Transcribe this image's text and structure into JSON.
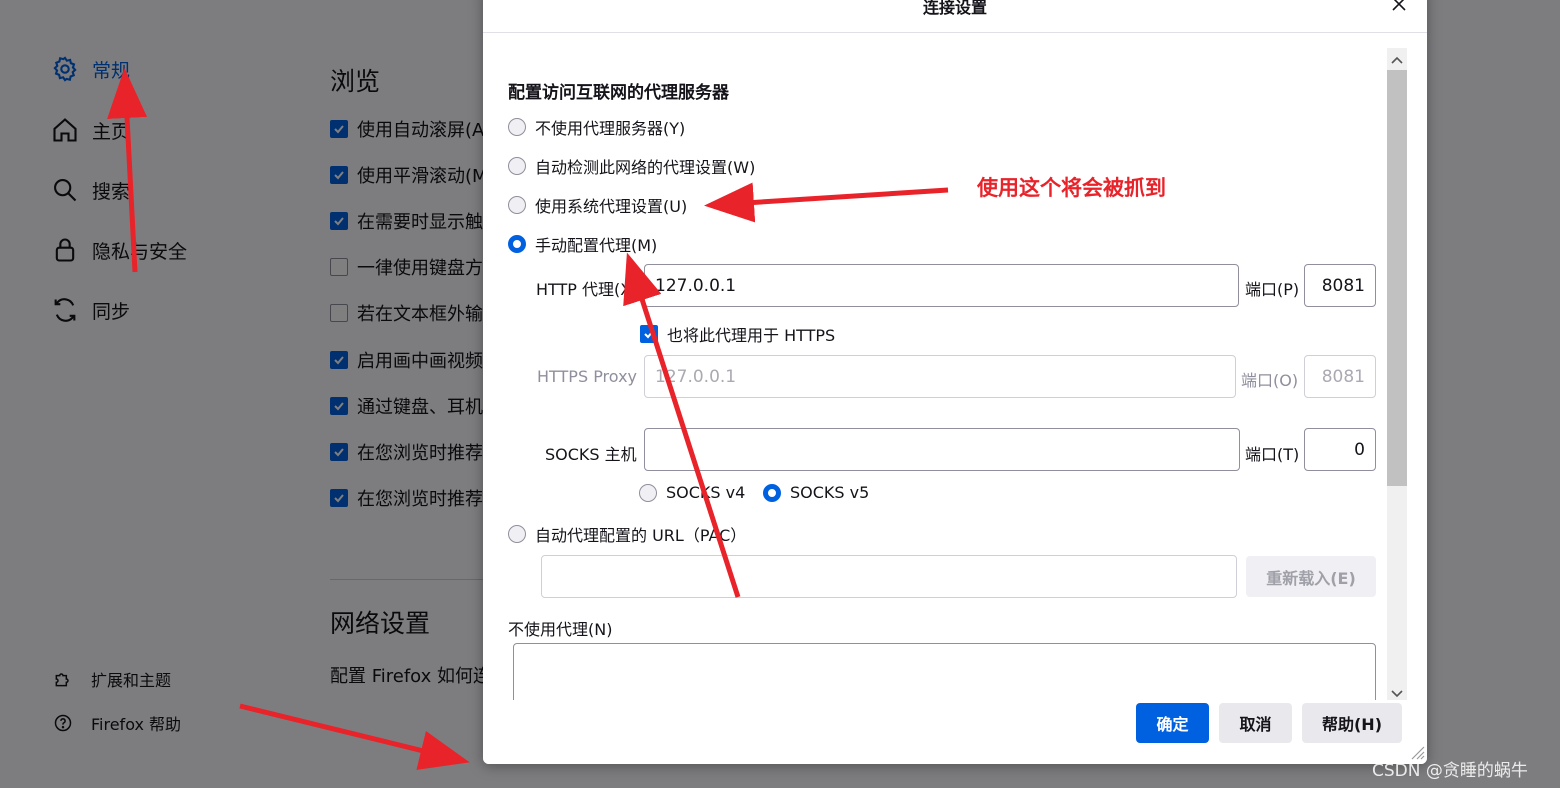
{
  "sidebar": {
    "items": [
      {
        "label": "常规",
        "icon": "gear-icon",
        "active": true
      },
      {
        "label": "主页",
        "icon": "home-icon"
      },
      {
        "label": "搜索",
        "icon": "search-icon"
      },
      {
        "label": "隐私与安全",
        "icon": "lock-icon"
      },
      {
        "label": "同步",
        "icon": "sync-icon"
      }
    ],
    "footer": [
      {
        "label": "扩展和主题",
        "icon": "puzzle-icon"
      },
      {
        "label": "Firefox 帮助",
        "icon": "help-icon"
      }
    ]
  },
  "browse": {
    "title": "浏览",
    "options": [
      {
        "label": "使用自动滚屏(A",
        "checked": true
      },
      {
        "label": "使用平滑滚动(M",
        "checked": true
      },
      {
        "label": "在需要时显示触",
        "checked": true
      },
      {
        "label": "一律使用键盘方",
        "checked": false
      },
      {
        "label": "若在文本框外输",
        "checked": false
      },
      {
        "label": "启用画中画视频",
        "checked": true
      },
      {
        "label": "通过键盘、耳机",
        "checked": true
      },
      {
        "label": "在您浏览时推荐",
        "checked": true
      },
      {
        "label": "在您浏览时推荐",
        "checked": true
      }
    ]
  },
  "network": {
    "title": "网络设置",
    "description": "配置 Firefox 如何连"
  },
  "dialog": {
    "title": "连接设置",
    "heading": "配置访问互联网的代理服务器",
    "proxy_options": {
      "none": "不使用代理服务器(Y)",
      "auto_detect": "自动检测此网络的代理设置(W)",
      "system": "使用系统代理设置(U)",
      "manual": "手动配置代理(M)",
      "pac": "自动代理配置的 URL（PAC）"
    },
    "selected": "manual",
    "http": {
      "label": "HTTP 代理(X)",
      "value": "127.0.0.1",
      "port_label": "端口(P)",
      "port": "8081"
    },
    "also_https": {
      "label": "也将此代理用于 HTTPS",
      "checked": true
    },
    "https": {
      "label": "HTTPS Proxy",
      "value": "127.0.0.1",
      "port_label": "端口(O)",
      "port": "8081"
    },
    "socks": {
      "label": "SOCKS 主机",
      "value": "",
      "port_label": "端口(T)",
      "port": "0"
    },
    "socks_version": {
      "v4": "SOCKS v4",
      "v5": "SOCKS v5",
      "selected": "v5"
    },
    "pac_url": "",
    "reload_label": "重新载入(E)",
    "no_proxy_label": "不使用代理(N)",
    "no_proxy_value": "",
    "buttons": {
      "ok": "确定",
      "cancel": "取消",
      "help": "帮助(H)"
    }
  },
  "annotation": {
    "text": "使用这个将会被抓到",
    "color": "#e8232a"
  },
  "watermark": "CSDN @贪睡的蜗牛",
  "colors": {
    "accent": "#0061e0",
    "annotation": "#e8232a"
  }
}
